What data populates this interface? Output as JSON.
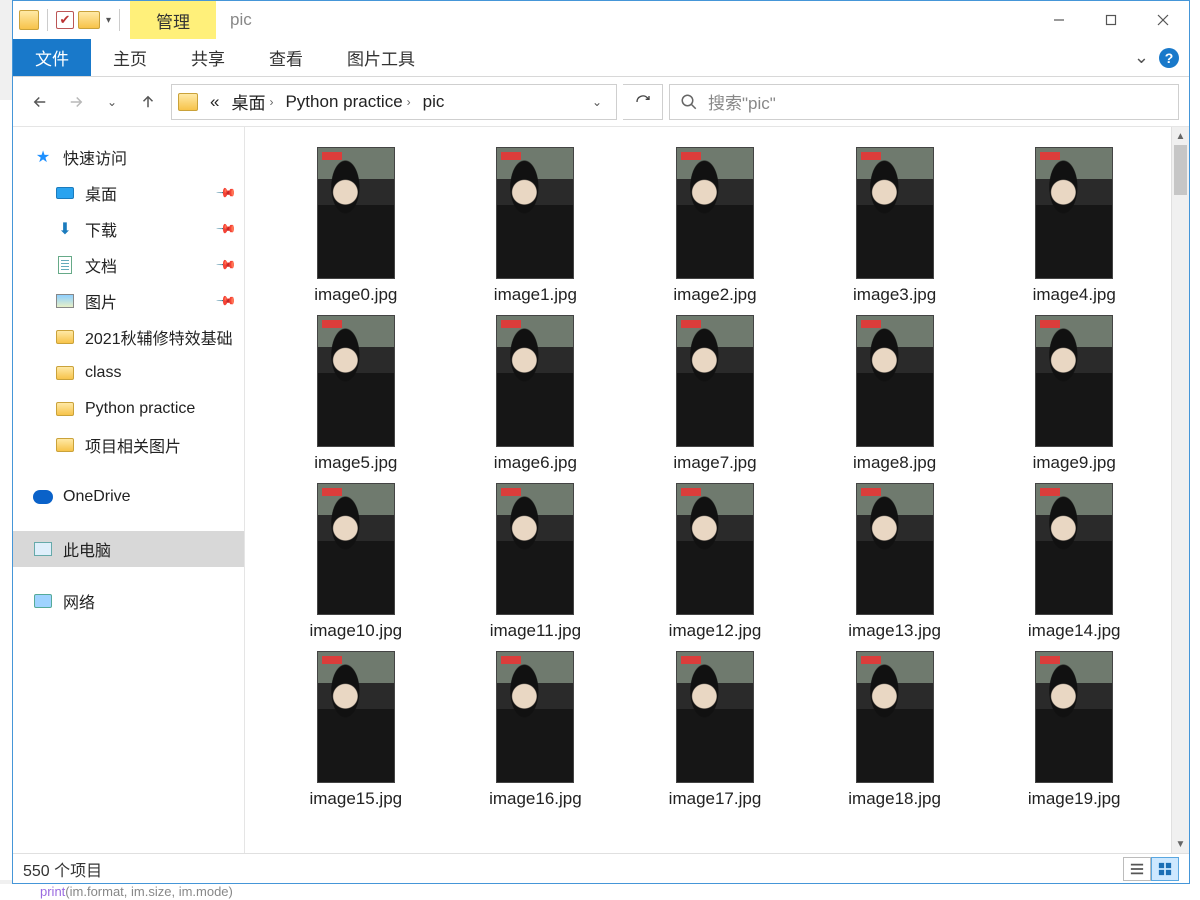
{
  "titlebar": {
    "manage_label": "管理",
    "window_title": "pic"
  },
  "ribbon": {
    "file_tab": "文件",
    "tabs": [
      "主页",
      "共享",
      "查看"
    ],
    "contextual_tab": "图片工具",
    "expand_chevron": "⌄"
  },
  "nav": {
    "breadcrumb": {
      "prefix": "«",
      "segments": [
        "桌面",
        "Python practice",
        "pic"
      ]
    },
    "search_placeholder": "搜索\"pic\""
  },
  "sidebar": {
    "quick_access": "快速访问",
    "pinned": [
      {
        "icon": "desktop",
        "label": "桌面"
      },
      {
        "icon": "download",
        "label": "下载"
      },
      {
        "icon": "doc",
        "label": "文档"
      },
      {
        "icon": "pic",
        "label": "图片"
      }
    ],
    "recent": [
      "2021秋辅修特效基础",
      "class",
      "Python practice",
      "项目相关图片"
    ],
    "onedrive": "OneDrive",
    "this_pc": "此电脑",
    "network": "网络"
  },
  "files": [
    "image0.jpg",
    "image1.jpg",
    "image2.jpg",
    "image3.jpg",
    "image4.jpg",
    "image5.jpg",
    "image6.jpg",
    "image7.jpg",
    "image8.jpg",
    "image9.jpg",
    "image10.jpg",
    "image11.jpg",
    "image12.jpg",
    "image13.jpg",
    "image14.jpg",
    "image15.jpg",
    "image16.jpg",
    "image17.jpg",
    "image18.jpg",
    "image19.jpg"
  ],
  "statusbar": {
    "item_count": "550 个项目"
  },
  "code_fragment": {
    "fn": "print",
    "rest": "(im.format, im.size, im.mode)"
  }
}
